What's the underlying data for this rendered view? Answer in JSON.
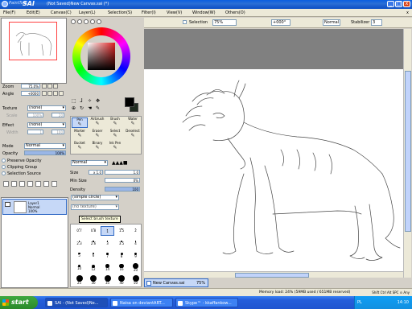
{
  "titlebar": {
    "logo_small": "PaintTool",
    "logo_big": "SAI",
    "title": "(Not Saved)New Canvas.sai (*)",
    "minimize": "_",
    "maximize": "□",
    "close": "x"
  },
  "menu": {
    "items": [
      "File(F)",
      "Edit(E)",
      "Canvas(C)",
      "Layer(L)",
      "Selection(S)",
      "Filter(I)",
      "View(V)",
      "Window(W)",
      "Others(O)"
    ],
    "close": "x"
  },
  "left": {
    "zoom_label": "Zoom",
    "zoom_value": "75.0%",
    "angle_label": "Angle",
    "angle_value": "+0000",
    "texture_label": "Texture",
    "texture_value": "(none)",
    "texture_scale_label": "Scale",
    "texture_scale_value": "100%",
    "texture_amount_label": "Amount",
    "texture_amount_value": "20",
    "effect_label": "Effect",
    "effect_value": "(none)",
    "effect_width_label": "Width",
    "effect_width_value": "1",
    "effect_amount_label": "Amount",
    "effect_amount_value": "100",
    "mode_label": "Mode",
    "mode_value": "Normal",
    "opacity_label": "Opacity",
    "opacity_value": "100%",
    "opacity_fraction": 1.0,
    "preserve_opacity": "Preserve Opacity",
    "clipping_group": "Clipping Group",
    "selection_source": "Selection Source",
    "layer": {
      "name": "Layer1",
      "mode": "Normal",
      "opacity": "100%"
    }
  },
  "color": {
    "fg": "#000000",
    "bg": "#202c20"
  },
  "tools": [
    {
      "label": "Pen",
      "icon": "pen-icon",
      "active": true
    },
    {
      "label": "Airbrush",
      "icon": "airbrush-icon",
      "active": false
    },
    {
      "label": "Brush",
      "icon": "brush-icon",
      "active": false
    },
    {
      "label": "Water",
      "icon": "water-icon",
      "active": false
    },
    {
      "label": "Marker",
      "icon": "marker-icon",
      "active": false
    },
    {
      "label": "Eraser",
      "icon": "eraser-icon",
      "active": false
    },
    {
      "label": "Select",
      "icon": "select-icon",
      "active": false
    },
    {
      "label": "Deselect",
      "icon": "deselect-icon",
      "active": false
    },
    {
      "label": "Bucket",
      "icon": "bucket-icon",
      "active": false
    },
    {
      "label": "Binary",
      "icon": "binary-icon",
      "active": false
    },
    {
      "label": "Ink Pen",
      "icon": "inkpen-icon",
      "active": false
    }
  ],
  "brush": {
    "mode_value": "Normal",
    "size_label": "Size",
    "size_mult": "x 1.0",
    "size_value": "1.0",
    "min_size_label": "Min Size",
    "min_size_value": "0%",
    "density_label": "Density",
    "density_value": "100",
    "density_fraction": 1.0,
    "shape_value": "(simple circle)",
    "texture_value": "(no texture)",
    "tooltip": "Select brush texture",
    "sizes": [
      "0.7",
      "0.8",
      "1",
      "1.5",
      "2",
      "2.3",
      "2.6",
      "3",
      "3.5",
      "4",
      "5",
      "6",
      "7",
      "8",
      "9",
      "10",
      "12",
      "14",
      "16",
      "20",
      "25",
      "30",
      "35",
      "40",
      "50"
    ],
    "selected_size": "1"
  },
  "canvas_toolbar": {
    "selection_label": "Selection",
    "zoom_value": "75%",
    "angle_value": "+000°",
    "mode_value": "Normal",
    "stabilizer_label": "Stabilizer",
    "stabilizer_value": "3"
  },
  "doc_tab": {
    "name": "New Canvas.sai",
    "zoom": "75%"
  },
  "status": {
    "memory": "Memory load: 24% (59MB used / 651MB reserved)",
    "keys": "Shift Ctrl Alt SPC ⊙ Any"
  },
  "taskbar": {
    "start": "start",
    "tasks": [
      "SAI - (Not Saved)Ne...",
      "Naisa on deviantART...",
      "Skype™ - kkaffankow..."
    ],
    "lang": "PL",
    "clock": "14:10"
  }
}
